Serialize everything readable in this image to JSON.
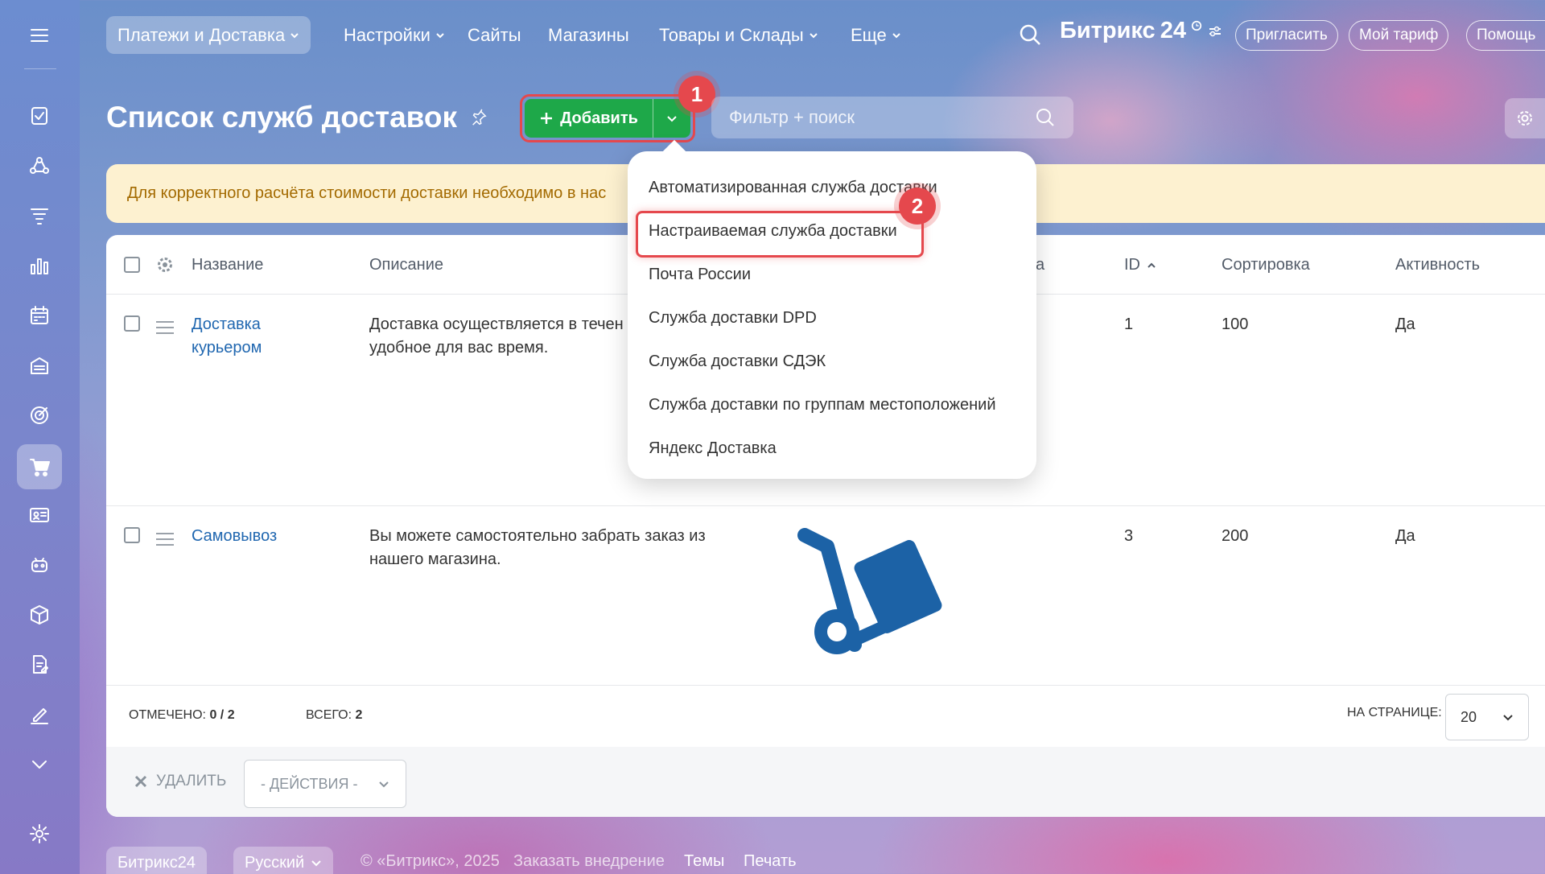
{
  "nav": {
    "items": [
      {
        "label": "Платежи и Доставка",
        "dropdown": true,
        "active": true
      },
      {
        "label": "Настройки",
        "dropdown": true
      },
      {
        "label": "Сайты",
        "dropdown": false
      },
      {
        "label": "Магазины",
        "dropdown": false
      },
      {
        "label": "Товары и Склады",
        "dropdown": true
      },
      {
        "label": "Еще",
        "dropdown": true
      }
    ],
    "brand": "Битрикс",
    "brand_number": "24",
    "invite_label": "Пригласить",
    "tariff_label": "Мой тариф",
    "help_label": "Помощь"
  },
  "page": {
    "title": "Список служб доставок",
    "add_label": "Добавить",
    "filter_placeholder": "Фильтр + поиск",
    "badge_1": "1",
    "badge_2": "2"
  },
  "banner": {
    "text": "Для корректного расчёта стоимости доставки необходимо в нас"
  },
  "dropdown": {
    "items": [
      "Автоматизированная служба доставки",
      "Настраиваемая служба доставки",
      "Почта России",
      "Служба доставки DPD",
      "Служба доставки СДЭК",
      "Служба доставки по группам местоположений",
      "Яндекс Доставка"
    ]
  },
  "table": {
    "headers": {
      "name": "Название",
      "description": "Описание",
      "col_partial": "а",
      "id": "ID",
      "sort": "Сортировка",
      "active": "Активность"
    },
    "rows": [
      {
        "name_line1": "Доставка",
        "name_line2": "курьером",
        "desc_line1": "Доставка осуществляется в течен",
        "desc_line2": "удобное для вас время.",
        "id": "1",
        "sort": "100",
        "active": "Да"
      },
      {
        "name_line1": "Самовывоз",
        "name_line2": "",
        "desc_line1": "Вы можете самостоятельно забрать заказ из",
        "desc_line2": "нашего магазина.",
        "id": "3",
        "sort": "200",
        "active": "Да"
      }
    ]
  },
  "footer": {
    "selected_label": "Отмечено:",
    "selected_value": "0 / 2",
    "total_label": "Всего:",
    "total_value": "2",
    "per_page_label": "На странице:",
    "per_page_value": "20",
    "delete_label": "Удалить",
    "actions_label": "- Действия -"
  },
  "page_footer": {
    "brand": "Битрикс24",
    "language": "Русский",
    "copyright": "© «Битрикс», 2025",
    "order_link": "Заказать внедрение",
    "themes_link": "Темы",
    "print_link": "Печать"
  },
  "colors": {
    "accent_green": "#1ea849",
    "highlight_red": "#e5484d",
    "link_blue": "#2067b0",
    "banner_bg": "#fdf1d0",
    "icon_blue": "#1c62a6"
  }
}
